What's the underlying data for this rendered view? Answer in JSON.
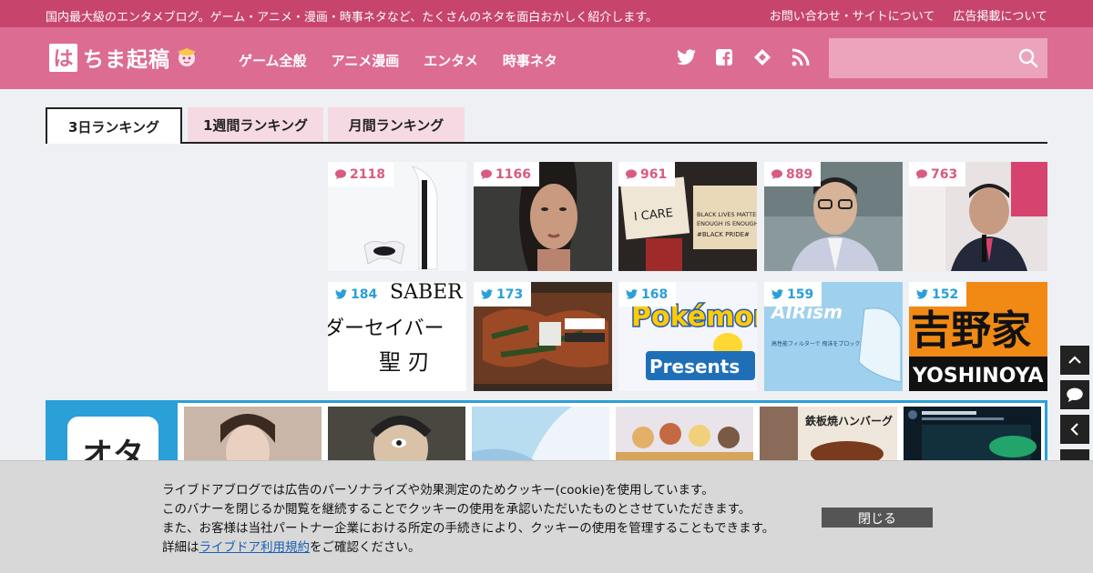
{
  "topbar": {
    "tagline": "国内最大級のエンタメブログ。ゲーム・アニメ・漫画・時事ネタなど、たくさんのネタを面白おかしく紹介します。",
    "links": [
      "お問い合わせ・サイトについて",
      "広告掲載について"
    ]
  },
  "header": {
    "logo_mark": "は",
    "logo_text": "ちま起稿",
    "nav": [
      "ゲーム全般",
      "アニメ漫画",
      "エンタメ",
      "時事ネタ"
    ],
    "search": {
      "placeholder": ""
    }
  },
  "tabs": [
    "3日ランキング",
    "1週間ランキング",
    "月間ランキング"
  ],
  "ranking": {
    "comment_row": [
      {
        "count": "2118",
        "icon": "comment-icon"
      },
      {
        "count": "1166",
        "icon": "comment-icon"
      },
      {
        "count": "961",
        "icon": "comment-icon"
      },
      {
        "count": "889",
        "icon": "comment-icon"
      },
      {
        "count": "763",
        "icon": "comment-icon"
      }
    ],
    "tweet_row": [
      {
        "count": "184",
        "icon": "twitter-icon"
      },
      {
        "count": "173",
        "icon": "twitter-icon"
      },
      {
        "count": "168",
        "icon": "twitter-icon"
      },
      {
        "count": "159",
        "icon": "twitter-icon"
      },
      {
        "count": "152",
        "icon": "twitter-icon"
      }
    ]
  },
  "image_text": {
    "saber_top": "SABER",
    "saber_mid": "ダーセイバー",
    "saber_bottom": "聖 刃",
    "protest_1": "I CARE",
    "protest_2": "BLACK LIVES MATTER ENOUGH IS ENOUGH #BLACK PRIDE#",
    "pokemon_1": "Pokémon",
    "pokemon_2": "Presents",
    "airism_1": "AIRism",
    "airism_2": "高性能フィルターで 飛沫をブロック。",
    "yoshinoya_1": "吉野家",
    "yoshinoya_2": "YOSHINOYA",
    "hamburg": "鉄板焼ハンバーグ"
  },
  "pickup": {
    "app_label": "オタ"
  },
  "cookie": {
    "line1": "ライブドアブログでは広告のパーソナライズや効果測定のためクッキー(cookie)を使用しています。",
    "line2": "このバナーを閉じるか閲覧を継続することでクッキーの使用を承認いただいたものとさせていただきます。",
    "line3": "また、お客様は当社パートナー企業における所定の手続きにより、クッキーの使用を管理することもできます。",
    "line4_pre": "詳細は",
    "line4_link": "ライブドア利用規約",
    "line4_post": "をご確認ください。",
    "close": "閉じる"
  },
  "colors": {
    "brand_dark": "#c7446d",
    "brand": "#dd6c92",
    "twitter": "#2a9fd8",
    "comment": "#d95b80"
  }
}
